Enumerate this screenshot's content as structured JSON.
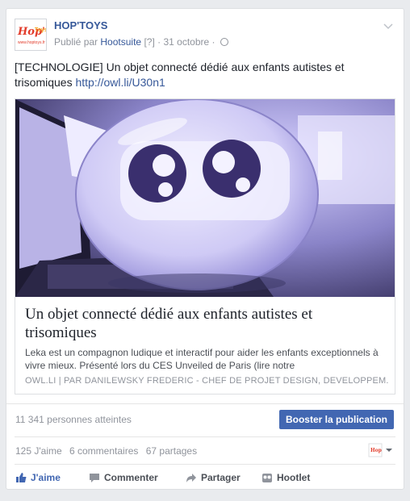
{
  "post": {
    "page_name": "HOP'TOYS",
    "logo": {
      "brand": "Hop'Toys",
      "url_text": "www.hoptoys.fr"
    },
    "meta": {
      "published_by": "Publié par",
      "tool": "Hootsuite",
      "help": "[?]",
      "separator": "·",
      "date": "31 octobre",
      "separator2": "·",
      "audience_icon": "globe-icon"
    },
    "text": "[TECHNOLOGIE] Un objet connecté dédié aux enfants autistes et trisomiques",
    "link": "http://owl.li/U30n1"
  },
  "attachment": {
    "title": "Un objet connecté dédié aux enfants autistes et trisomiques",
    "description": "Leka est un compagnon ludique et interactif pour aider les enfants exceptionnels à vivre mieux. Présenté lors du CES Unveiled de Paris (lire notre",
    "source": "OWL.LI  |  PAR DANILEWSKY FREDERIC - CHEF DE PROJET DESIGN, DEVELOPPEM..."
  },
  "reach": {
    "text": "11 341 personnes atteintes",
    "boost_label": "Booster la publication"
  },
  "counts": {
    "likes": "125 J'aime",
    "comments": "6 commentaires",
    "shares": "67 partages"
  },
  "actions": {
    "like": "J'aime",
    "comment": "Commenter",
    "share": "Partager",
    "hootlet": "Hootlet"
  },
  "colors": {
    "link": "#365899",
    "boost": "#4267b2",
    "photo_tint": "#6f6aa6"
  }
}
